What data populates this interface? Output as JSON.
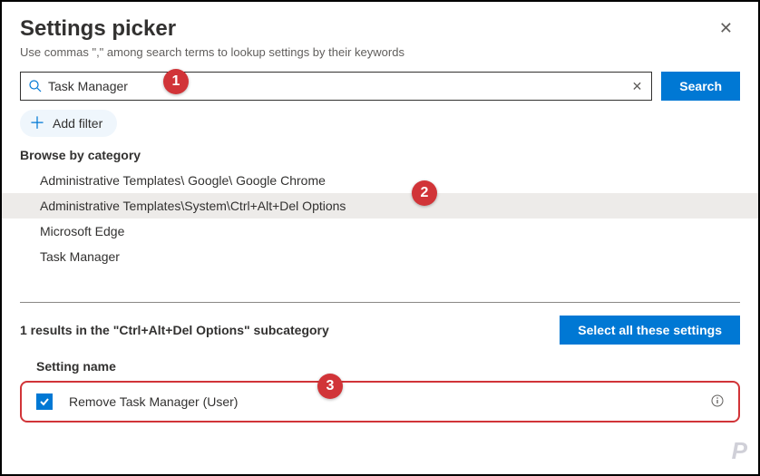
{
  "header": {
    "title": "Settings picker",
    "subtitle": "Use commas \",\" among search terms to lookup settings by their keywords"
  },
  "search": {
    "value": "Task Manager",
    "button": "Search"
  },
  "filter": {
    "add_label": "Add filter"
  },
  "browse": {
    "label": "Browse by category",
    "categories": [
      "Administrative Templates\\ Google\\ Google Chrome",
      "Administrative Templates\\System\\Ctrl+Alt+Del Options",
      "Microsoft Edge",
      "Task Manager"
    ],
    "selected_index": 1
  },
  "results": {
    "summary": "1 results in the \"Ctrl+Alt+Del Options\" subcategory",
    "select_all": "Select all these settings",
    "column_header": "Setting name",
    "items": [
      {
        "name": "Remove Task Manager (User)",
        "checked": true
      }
    ]
  },
  "callouts": {
    "c1": "1",
    "c2": "2",
    "c3": "3"
  },
  "watermark": "P"
}
